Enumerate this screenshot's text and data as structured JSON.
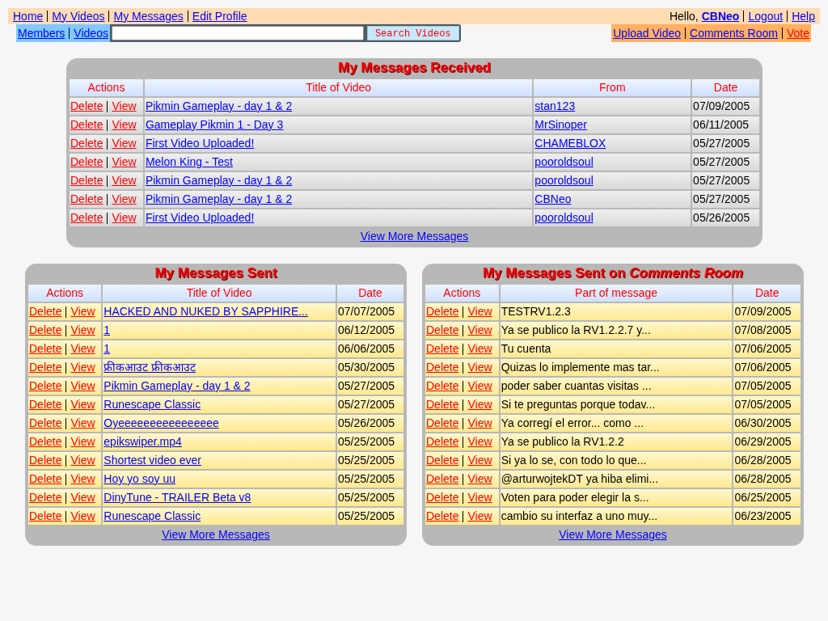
{
  "top_nav": {
    "left": [
      {
        "label": "Home"
      },
      {
        "label": "My Videos"
      },
      {
        "label": "My Messages"
      },
      {
        "label": "Edit Profile"
      }
    ],
    "greeting": "Hello,",
    "user": "CBNeo",
    "right": [
      {
        "label": "Logout"
      },
      {
        "label": "Help"
      }
    ]
  },
  "sub_nav": {
    "left": [
      {
        "label": "Members"
      },
      {
        "label": "Videos"
      }
    ],
    "search": {
      "button": "Search Videos"
    },
    "right": [
      {
        "label": "Upload Video",
        "highlighted": false
      },
      {
        "label": "Comments Room",
        "highlighted": false
      },
      {
        "label": "Vote",
        "highlighted": true
      }
    ]
  },
  "received": {
    "title": "My Messages Received",
    "columns": [
      "Actions",
      "Title of Video",
      "From",
      "Date"
    ],
    "rows": [
      {
        "actions": [
          "Delete",
          "View"
        ],
        "title": "Pikmin Gameplay - day 1 & 2",
        "from": "stan123",
        "date": "07/09/2005"
      },
      {
        "actions": [
          "Delete",
          "View"
        ],
        "title": "Gameplay Pikmin 1 - Day 3",
        "from": "MrSinoper",
        "date": "06/11/2005"
      },
      {
        "actions": [
          "Delete",
          "View"
        ],
        "title": "First Video Uploaded!",
        "from": "CHAMEBLOX",
        "date": "05/27/2005"
      },
      {
        "actions": [
          "Delete",
          "View"
        ],
        "title": "Melon King - Test",
        "from": "pooroldsoul",
        "date": "05/27/2005"
      },
      {
        "actions": [
          "Delete",
          "View"
        ],
        "title": "Pikmin Gameplay - day 1 & 2",
        "from": "pooroldsoul",
        "date": "05/27/2005"
      },
      {
        "actions": [
          "Delete",
          "View"
        ],
        "title": "Pikmin Gameplay - day 1 & 2",
        "from": "CBNeo",
        "date": "05/27/2005"
      },
      {
        "actions": [
          "Delete",
          "View"
        ],
        "title": "First Video Uploaded!",
        "from": "pooroldsoul",
        "date": "05/26/2005"
      }
    ],
    "more": "View More Messages"
  },
  "sent": {
    "title": "My Messages Sent",
    "columns": [
      "Actions",
      "Title of Video",
      "Date"
    ],
    "rows": [
      {
        "actions": [
          "Delete",
          "View"
        ],
        "text": "HACKED AND NUKED BY SAPPHIRE...",
        "date": "07/07/2005"
      },
      {
        "actions": [
          "Delete",
          "View"
        ],
        "text": "1",
        "date": "06/12/2005"
      },
      {
        "actions": [
          "Delete",
          "View"
        ],
        "text": "1",
        "date": "06/06/2005"
      },
      {
        "actions": [
          "Delete",
          "View"
        ],
        "text": "फ्रीकआउट फ्रीकआउट",
        "date": "05/30/2005"
      },
      {
        "actions": [
          "Delete",
          "View"
        ],
        "text": "Pikmin Gameplay - day 1 & 2",
        "date": "05/27/2005"
      },
      {
        "actions": [
          "Delete",
          "View"
        ],
        "text": "Runescape Classic",
        "date": "05/27/2005"
      },
      {
        "actions": [
          "Delete",
          "View"
        ],
        "text": "Oyeeeeeeeeeeeeeeee",
        "date": "05/26/2005"
      },
      {
        "actions": [
          "Delete",
          "View"
        ],
        "text": "epikswiper.mp4",
        "date": "05/25/2005"
      },
      {
        "actions": [
          "Delete",
          "View"
        ],
        "text": "Shortest video ever",
        "date": "05/25/2005"
      },
      {
        "actions": [
          "Delete",
          "View"
        ],
        "text": "Hoy yo soy uu",
        "date": "05/25/2005"
      },
      {
        "actions": [
          "Delete",
          "View"
        ],
        "text": "DinyTune - TRAILER Beta v8",
        "date": "05/25/2005"
      },
      {
        "actions": [
          "Delete",
          "View"
        ],
        "text": "Runescape Classic",
        "date": "05/25/2005"
      }
    ],
    "more": "View More Messages"
  },
  "comments": {
    "title": "My Messages Sent on *Comments Room*",
    "columns": [
      "Actions",
      "Part of message",
      "Date"
    ],
    "rows": [
      {
        "actions": [
          "Delete",
          "View"
        ],
        "text": "TESTRV1.2.3",
        "date": "07/09/2005"
      },
      {
        "actions": [
          "Delete",
          "View"
        ],
        "text": "Ya se publico la RV1.2.2.7 y...",
        "date": "07/08/2005"
      },
      {
        "actions": [
          "Delete",
          "View"
        ],
        "text": "Tu cuenta",
        "date": "07/06/2005"
      },
      {
        "actions": [
          "Delete",
          "View"
        ],
        "text": "Quizas lo implemente mas tar...",
        "date": "07/06/2005"
      },
      {
        "actions": [
          "Delete",
          "View"
        ],
        "text": "poder saber cuantas visitas ...",
        "date": "07/05/2005"
      },
      {
        "actions": [
          "Delete",
          "View"
        ],
        "text": "Si te preguntas porque todav...",
        "date": "07/05/2005"
      },
      {
        "actions": [
          "Delete",
          "View"
        ],
        "text": "Ya corregí el error... como ...",
        "date": "06/30/2005"
      },
      {
        "actions": [
          "Delete",
          "View"
        ],
        "text": "Ya se publico la RV1.2.2",
        "date": "06/29/2005"
      },
      {
        "actions": [
          "Delete",
          "View"
        ],
        "text": "Si ya lo se, con todo lo que...",
        "date": "06/28/2005"
      },
      {
        "actions": [
          "Delete",
          "View"
        ],
        "text": "@arturwojtekDT ya hiba elimi...",
        "date": "06/28/2005"
      },
      {
        "actions": [
          "Delete",
          "View"
        ],
        "text": "Voten para poder elegir la s...",
        "date": "06/25/2005"
      },
      {
        "actions": [
          "Delete",
          "View"
        ],
        "text": "cambio su interfaz a uno muy...",
        "date": "06/23/2005"
      }
    ],
    "more": "View More Messages"
  }
}
